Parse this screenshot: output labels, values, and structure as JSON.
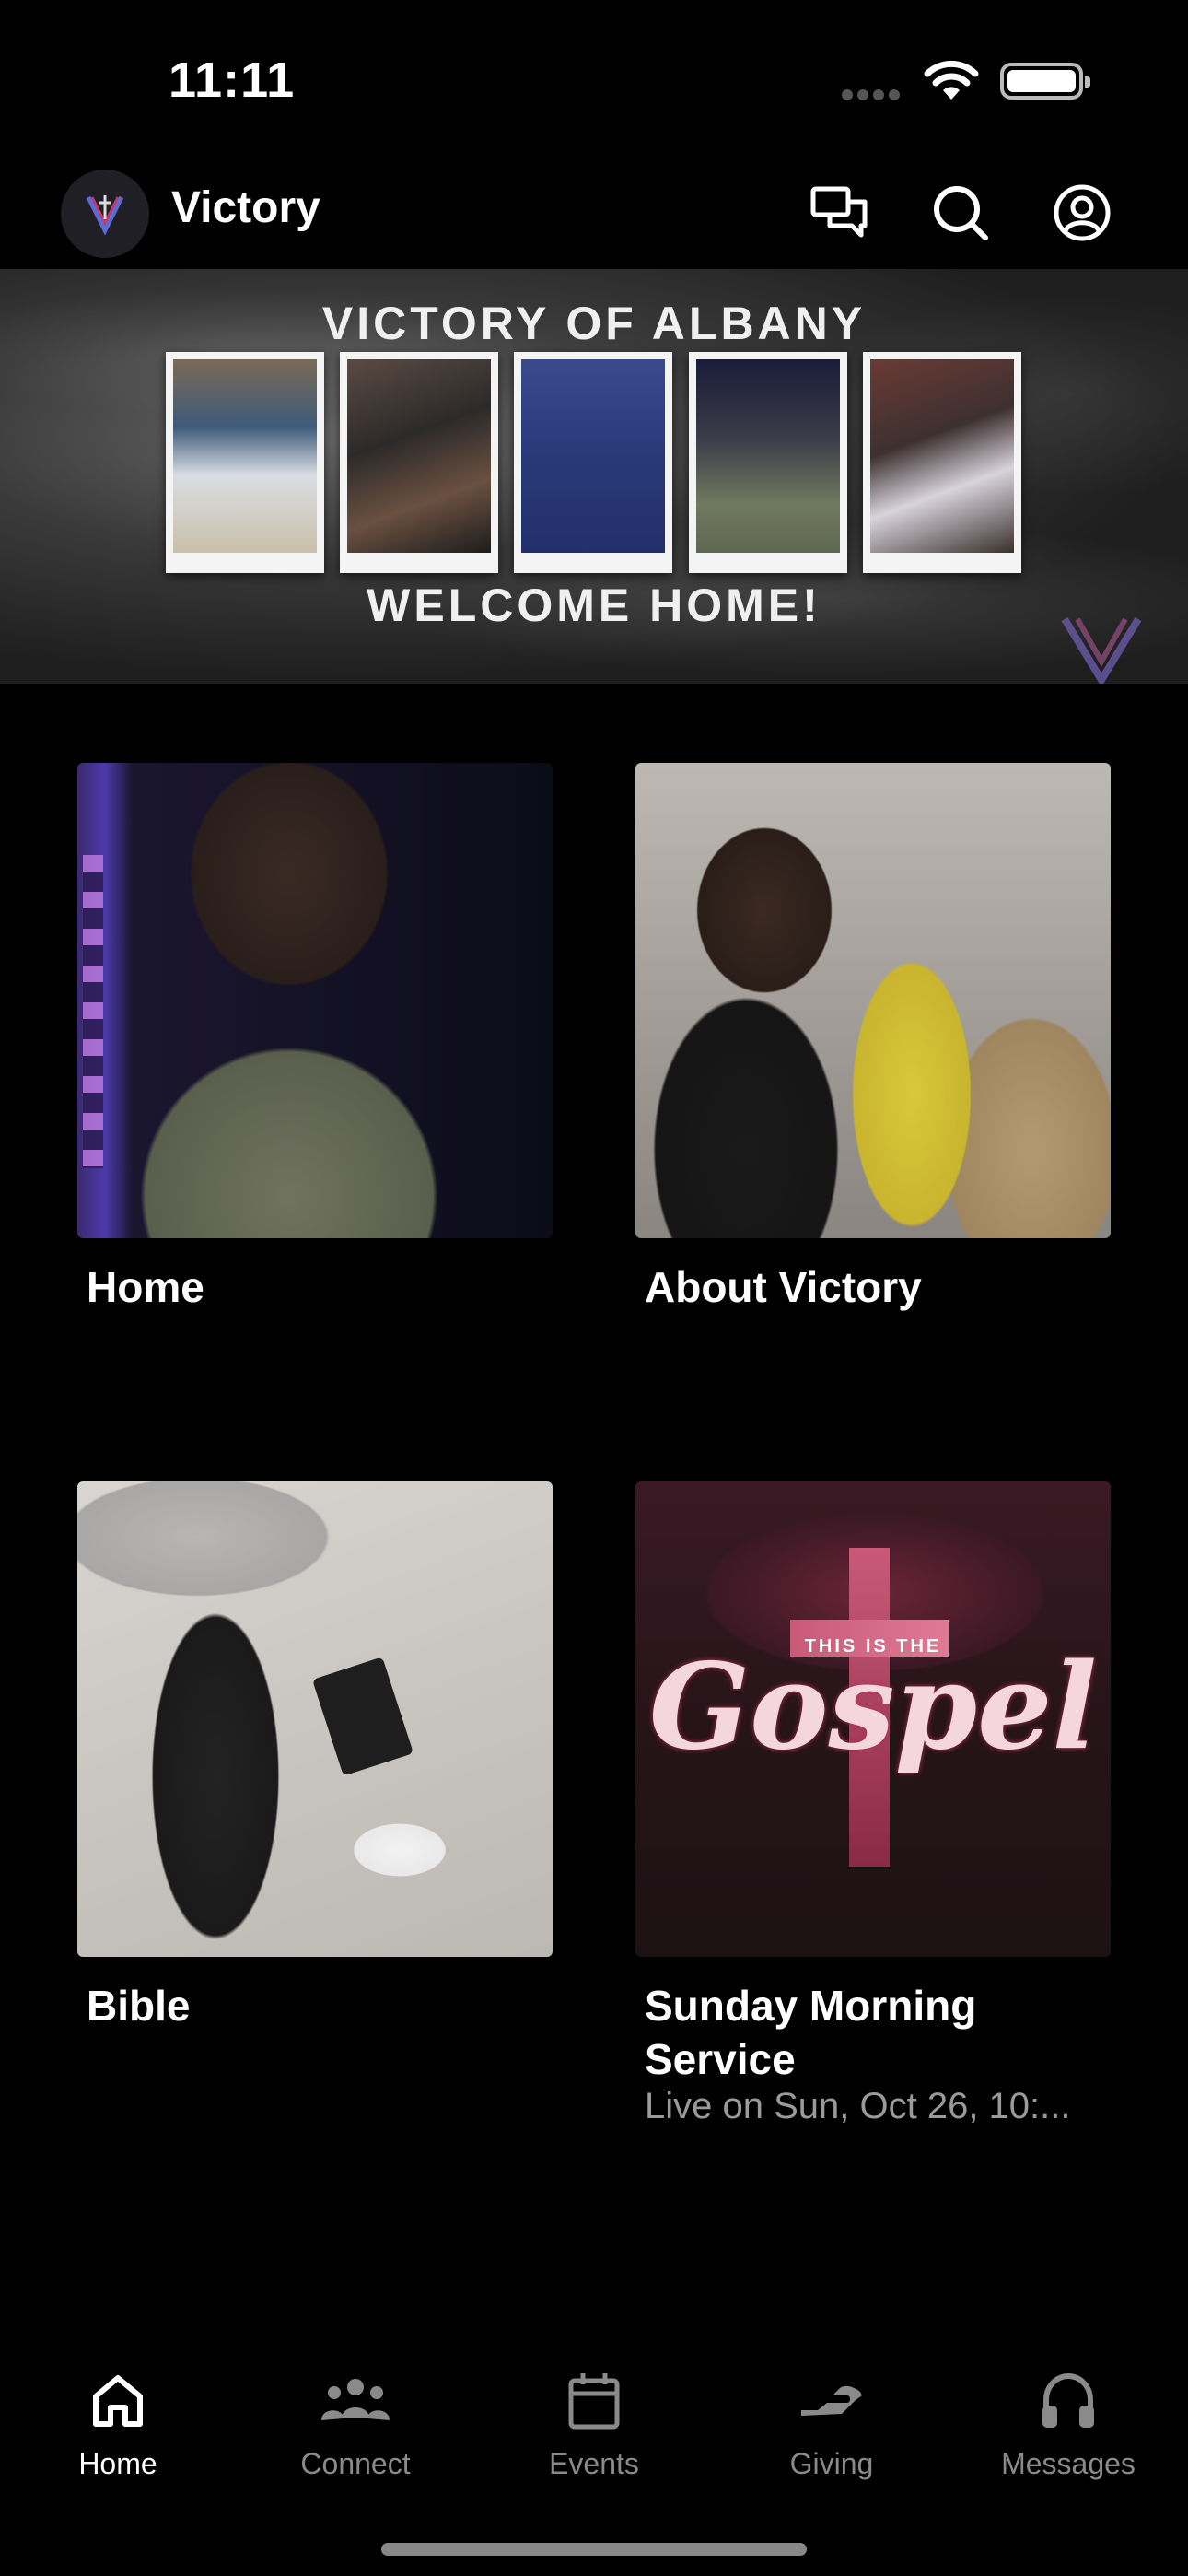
{
  "status_bar": {
    "time": "11:11"
  },
  "header": {
    "app_title": "Victory"
  },
  "banner": {
    "title": "VICTORY OF ALBANY",
    "subtitle": "WELCOME HOME!"
  },
  "tiles": [
    {
      "title": "Home",
      "subtitle": ""
    },
    {
      "title": "About Victory",
      "subtitle": ""
    },
    {
      "title": "Bible",
      "subtitle": ""
    },
    {
      "title": "Sunday Morning Service",
      "subtitle": "Live on Sun, Oct 26, 10:..."
    }
  ],
  "gospel_art": {
    "small": "THIS IS THE",
    "big": "Gospel"
  },
  "bottom_nav": {
    "items": [
      {
        "label": "Home",
        "icon": "home-icon",
        "active": true
      },
      {
        "label": "Connect",
        "icon": "group-icon",
        "active": false
      },
      {
        "label": "Events",
        "icon": "calendar-icon",
        "active": false
      },
      {
        "label": "Giving",
        "icon": "giving-hand-icon",
        "active": false
      },
      {
        "label": "Messages",
        "icon": "headphones-icon",
        "active": false
      }
    ]
  },
  "colors": {
    "background": "#000000",
    "text": "#ffffff",
    "muted": "#8a8a8a",
    "gospel_accent": "#e04a6a"
  }
}
